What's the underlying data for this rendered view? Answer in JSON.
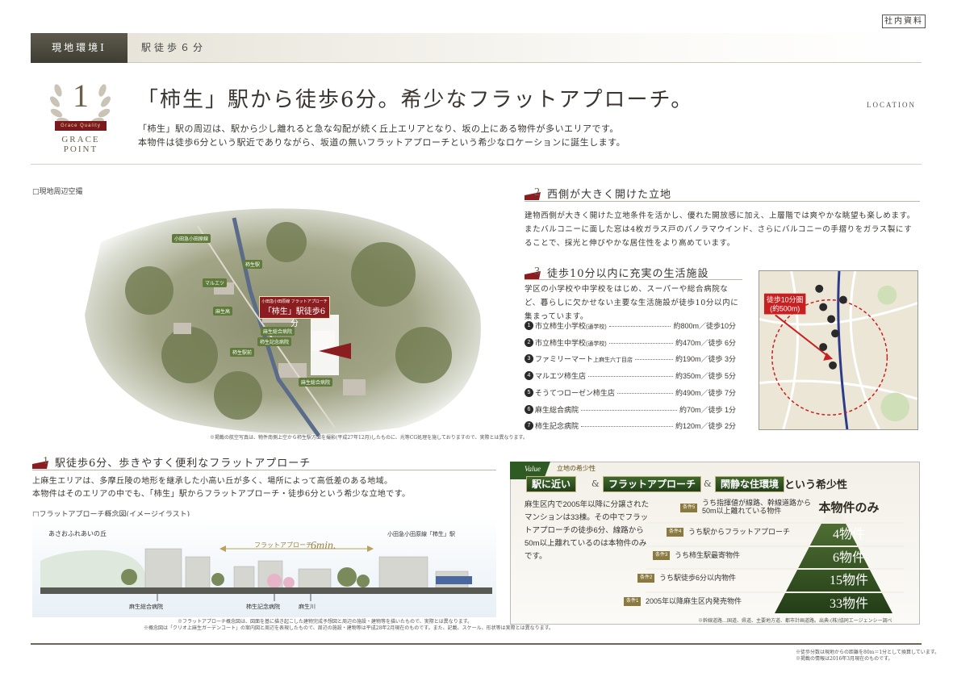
{
  "internal_label": "社内資料",
  "header": {
    "section": "現地環境Ⅰ",
    "subtitle": "駅徒歩６分"
  },
  "grace": {
    "number": "1",
    "ribbon": "Grace Quality",
    "label": "GRACE POINT"
  },
  "title": "「柿生」駅から徒歩6分。希少なフラットアプローチ。",
  "location": "LOCATION",
  "intro": [
    "「柿生」駅の周辺は、駅から少し離れると急な勾配が続く丘上エリアとなり、坂の上にある物件が多いエリアです。",
    "本物件は徒歩6分という駅近でありながら、坂道の無いフラットアプローチという希少なロケーションに誕生します。"
  ],
  "aerial": {
    "caption": "□現地周辺空撮",
    "note": "※掲載の航空写真は、物件南側上空から柿生駅方面を撮影(平成27年12月)したものに、光等CG処理を施しておりますので、実際とは異なります。",
    "tags": [
      "小田急小田原線",
      "柿生駅",
      "マルエツ",
      "麻生高",
      "麻生総合病院",
      "柿生記念病院",
      "柿生駅前",
      "麻生総合病院"
    ],
    "bigtag_small": "小田急小田原線 フラットアプローチ",
    "bigtag_big": "「柿生」駅徒歩6分"
  },
  "sec2": {
    "title": "西側が大きく開けた立地",
    "body": "建物西側が大きく開けた立地条件を活かし、優れた開放感に加え、上層階では爽やかな眺望も楽しめます。またバルコニーに面した窓は4枚ガラス戸のパノラマウインド、さらにバルコニーの手摺りをガラス製にすることで、採光と伸びやかな居住性をより高めています。"
  },
  "sec3": {
    "title": "徒歩10分以内に充実の生活施設",
    "body": "学区の小学校や中学校をはじめ、スーパーや総合病院など、暮らしに欠かせない主要な生活施設が徒歩10分以内に集まっています。",
    "facilities": [
      {
        "num": "1",
        "name": "市立柿生小学校",
        "sub": "(通学校)",
        "dist": "約800m／徒歩10分"
      },
      {
        "num": "2",
        "name": "市立柿生中学校",
        "sub": "(通学校)",
        "dist": "約470m／徒歩 6分"
      },
      {
        "num": "3",
        "name": "ファミリーマート",
        "sub": "上麻生六丁目店",
        "dist": "約190m／徒歩 3分"
      },
      {
        "num": "4",
        "name": "マルエツ柿生店",
        "sub": "",
        "dist": "約350m／徒歩 5分"
      },
      {
        "num": "5",
        "name": "そうてつローゼン柿生店",
        "sub": "",
        "dist": "約490m／徒歩 7分"
      },
      {
        "num": "6",
        "name": "麻生総合病院",
        "sub": "",
        "dist": "約70m／徒歩 1分"
      },
      {
        "num": "7",
        "name": "柿生記念病院",
        "sub": "",
        "dist": "約120m／徒歩 2分"
      }
    ],
    "map_label1": "徒歩10分圏",
    "map_label2": "(約500m)"
  },
  "sec1": {
    "title": "駅徒歩6分、歩きやすく便利なフラットアプローチ",
    "body1": "上麻生エリアは、多摩丘陵の地形を継承した小高い丘が多く、場所によって高低差のある地域。",
    "body2": "本物件はそのエリアの中でも、「柿生」駅からフラットアプローチ・徒歩6分という希少な立地です。",
    "ill_caption": "□フラットアプローチ概念図(イメージイラスト)",
    "ill_left": "あさおふれあいの丘",
    "ill_right": "小田急小田原線「柿生」駅",
    "ill_arrow": "フラットアプローチ",
    "ill_min": "6min.",
    "ill_b1": "麻生総合病院",
    "ill_b2": "柿生記念病院",
    "ill_b3": "麻生川",
    "note1": "※フラットアプローチ概念図は、図面を基に描き起こした建物完成予想図と周辺の施設・建物等を描いたもので、実際とは異なります。",
    "note2": "※概念図は「クリオ上麻生ガーデンコート」の案内図と周辺を表現したもので、周辺の施設・建物等は平成28年2月現在のものです。また、記載、スケール、形状等は実際とは異なります。"
  },
  "value": {
    "flag": "Value",
    "sub": "立地の希少性",
    "chips": [
      "駅に近い",
      "フラットアプローチ",
      "閑静な住環境"
    ],
    "amp": "&",
    "tail": "という希少性",
    "desc": "麻生区内で2005年以降に分譲されたマンションは33棟。その中でフラットアプローチの徒歩6分、線路から50m以上離れているのは本物件のみです。",
    "conditions": [
      {
        "tag": "条件5",
        "text": "うち指揮値が線路、幹線道路から50m以上離れている物件",
        "value": "本物件のみ"
      },
      {
        "tag": "条件4",
        "text": "うち駅からフラットアプローチ",
        "value": "4物件"
      },
      {
        "tag": "条件3",
        "text": "うち柿生駅最寄物件",
        "value": "6物件"
      },
      {
        "tag": "条件2",
        "text": "うち駅徒歩6分以内物件",
        "value": "15物件"
      },
      {
        "tag": "条件1",
        "text": "2005年以降麻生区内発売物件",
        "value": "33物件"
      }
    ],
    "note": "※幹線道路…国道、県道、主要地方道、都市計画道路。出典:(株)協同エージェンシー調べ"
  },
  "footer": [
    "※徒歩分数は現地からの距離を80m＝1分として換算しています。",
    "※掲載の情報は2016年3月現在のものです。"
  ],
  "colors": {
    "accent": "#8b1d20",
    "green": "#2f5a24",
    "gold": "#8b7a3f"
  }
}
